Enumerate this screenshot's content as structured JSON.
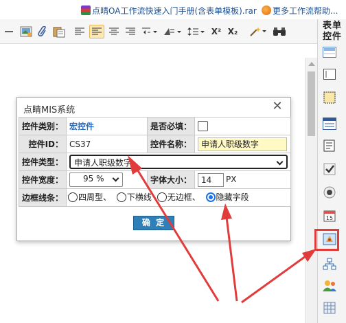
{
  "top_links": {
    "download": "点晴OA工作流快速入门手册(含表单模板).rar",
    "more_help": "更多工作流帮助..."
  },
  "toolbar": {
    "icons": [
      "horizontal-rule-icon",
      "image-icon",
      "attachment-icon",
      "paste-icon",
      "align-left-icon",
      "align-left-active-icon",
      "align-center-icon",
      "align-right-icon",
      "indent-icon",
      "outdent-icon",
      "line-spacing-icon",
      "superscript-icon",
      "subscript-icon",
      "magic-wand-icon",
      "binoculars-icon"
    ],
    "superscript": "X²",
    "subscript": "X₂"
  },
  "right_panel": {
    "title": "表单控件",
    "icons": [
      "single-line-text-icon",
      "multi-line-text-icon",
      "textarea-icon",
      "list-control-icon",
      "doc-control-icon",
      "checkbox-icon",
      "radio-icon",
      "calendar-icon",
      "macro-control-icon",
      "department-icon",
      "user-icon",
      "table-grid-icon"
    ],
    "calendar_day": "15"
  },
  "dialog": {
    "title": "点睛MIS系统",
    "close": "✕",
    "rows": {
      "type_label": "控件类别：",
      "type_value": "宏控件",
      "required_label": "是否必填：",
      "id_label": "控件ID：",
      "id_value": "CS37",
      "name_label": "控件名称：",
      "name_value": "申请人职级数字",
      "ctrl_type_label": "控件类型：",
      "ctrl_type_value": "申请人职级数字",
      "width_label": "控件宽度：",
      "width_value": "95 %",
      "font_label": "字体大小：",
      "font_value": "14",
      "font_unit": "PX",
      "border_label": "边框线条：",
      "border_options": [
        "四周型、",
        "下横线",
        "无边框、",
        "隐藏字段"
      ],
      "border_selected": "隐藏字段"
    },
    "ok_button": "确 定"
  },
  "colors": {
    "annotation_red": "#e23b3b",
    "accent_blue": "#2f7fb8",
    "highlight_yellow": "#fff9c4"
  }
}
